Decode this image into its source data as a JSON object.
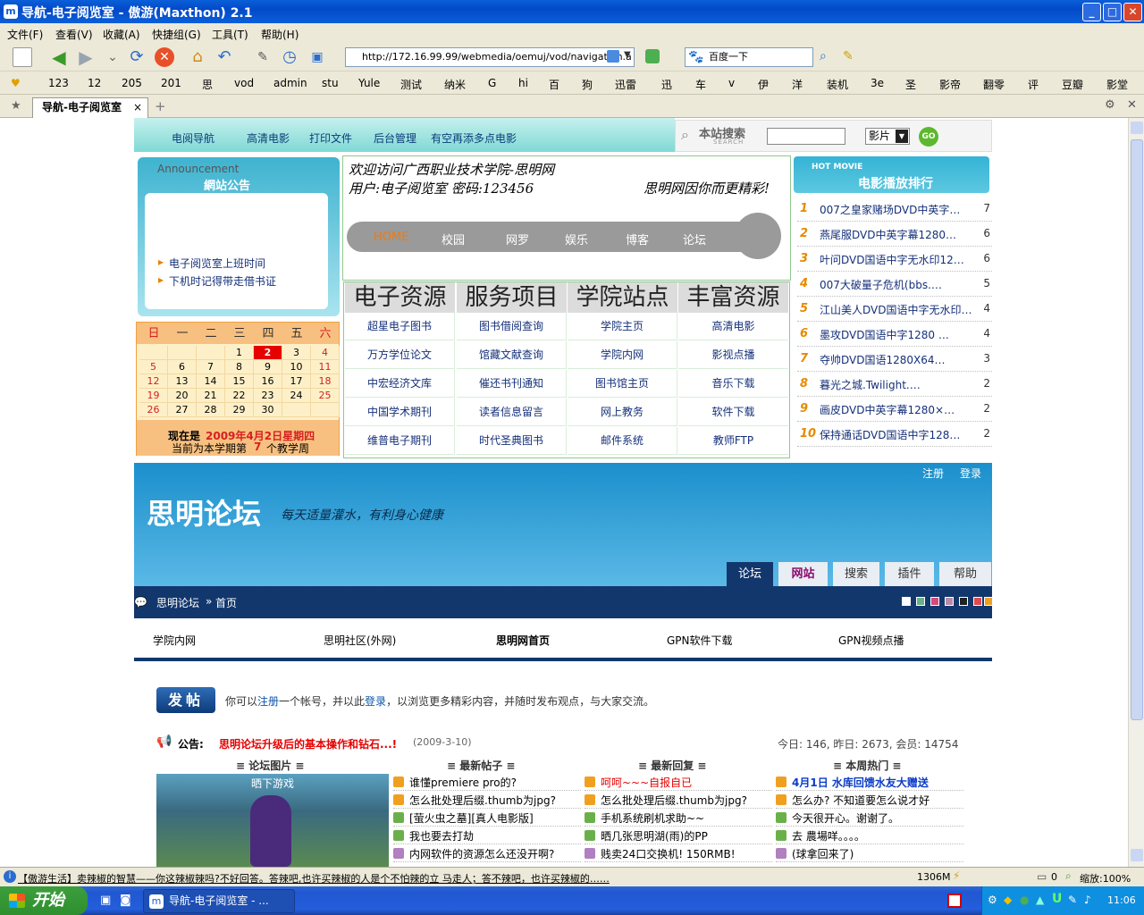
{
  "window": {
    "title": "导航-电子阅览室 - 傲游(Maxthon) 2.1",
    "buttons": [
      "_",
      "□",
      "✕"
    ]
  },
  "menu": [
    "文件(F)",
    "查看(V)",
    "收藏(A)",
    "快捷组(G)",
    "工具(T)",
    "帮助(H)"
  ],
  "toolbar": {
    "address": "http://172.16.99.99/webmedia/oemuj/vod/navigation.a",
    "search_placeholder": "百度一下"
  },
  "favorites": [
    "123",
    "12",
    "205",
    "201",
    "思",
    "vod",
    "admin",
    "stu",
    "Yule",
    "测试",
    "纳米",
    "G",
    "hi",
    "百",
    "狗",
    "迅雷",
    "迅",
    "车",
    "v",
    "伊",
    "洋",
    "装机",
    "3e",
    "圣",
    "影帝",
    "翻零",
    "评",
    "豆瓣",
    "影堂"
  ],
  "tab": {
    "label": "导航-电子阅览室"
  },
  "page": {
    "nav": [
      "电阅导航",
      "高清电影",
      "打印文件",
      "后台管理"
    ],
    "nav_note": "有空再添多点电影",
    "site_search": {
      "title": "本站搜索",
      "sub": "SEARCH",
      "select": "影片",
      "go": "GO"
    },
    "announcement": {
      "title_en": "Announcement",
      "title_cn": "網站公告",
      "items": [
        "电子阅览室上班时间",
        "下机时记得带走借书证"
      ]
    },
    "calendar": {
      "headers": [
        "日",
        "一",
        "二",
        "三",
        "四",
        "五",
        "六"
      ],
      "rows": [
        [
          "",
          "",
          "",
          "1",
          "2",
          "3",
          "4"
        ],
        [
          "5",
          "6",
          "7",
          "8",
          "9",
          "10",
          "11"
        ],
        [
          "12",
          "13",
          "14",
          "15",
          "16",
          "17",
          "18"
        ],
        [
          "19",
          "20",
          "21",
          "22",
          "23",
          "24",
          "25"
        ],
        [
          "26",
          "27",
          "28",
          "29",
          "30",
          "",
          ""
        ]
      ],
      "today": "2",
      "now_prefix": "现在是",
      "now_date": "2009年4月2日星期四",
      "week_prefix": "当前为本学期第",
      "week_num": "7",
      "week_suffix": "个教学周"
    },
    "welcome": {
      "line1": "欢迎访问广西职业技术学院-思明网",
      "line2": "用户:电子阅览室  密码:123456",
      "slogan": "思明网因你而更精彩!",
      "menu": [
        "HOME",
        "校园",
        "网罗",
        "娱乐",
        "博客",
        "论坛"
      ]
    },
    "grid": {
      "headers": [
        "电子资源",
        "服务项目",
        "学院站点",
        "丰富资源"
      ],
      "rows": [
        [
          "超星电子图书",
          "图书借阅查询",
          "学院主页",
          "高清电影"
        ],
        [
          "万方学位论文",
          "馆藏文献查询",
          "学院内网",
          "影视点播"
        ],
        [
          "中宏经济文库",
          "催还书刊通知",
          "图书馆主页",
          "音乐下载"
        ],
        [
          "中国学术期刊",
          "读者信息留言",
          "网上教务",
          "软件下载"
        ],
        [
          "维普电子期刊",
          "时代圣典图书",
          "邮件系统",
          "教师FTP"
        ]
      ]
    },
    "hot": {
      "title_en": "HOT MOVIE",
      "title_cn": "电影播放排行",
      "items": [
        {
          "n": "1",
          "t": "007之皇家赌场DVD中英字…",
          "c": "7"
        },
        {
          "n": "2",
          "t": "燕尾服DVD中英字幕1280…",
          "c": "6"
        },
        {
          "n": "3",
          "t": "叶问DVD国语中字无水印12…",
          "c": "6"
        },
        {
          "n": "4",
          "t": "007大破量子危机(bbs.…",
          "c": "5"
        },
        {
          "n": "5",
          "t": "江山美人DVD国语中字无水印…",
          "c": "4"
        },
        {
          "n": "6",
          "t": "墨攻DVD国语中字1280 …",
          "c": "4"
        },
        {
          "n": "7",
          "t": "夺帅DVD国语1280X64…",
          "c": "3"
        },
        {
          "n": "8",
          "t": "暮光之城.Twilight.…",
          "c": "2"
        },
        {
          "n": "9",
          "t": "画皮DVD中英字幕1280×…",
          "c": "2"
        },
        {
          "n": "10",
          "t": "保持通话DVD国语中字128…",
          "c": "2"
        }
      ]
    },
    "forum": {
      "register": "注册",
      "login": "登录",
      "logo": "思明论坛",
      "slogan": "每天适量灌水，有利身心健康",
      "tabs": [
        "论坛",
        "网站",
        "搜索",
        "插件",
        "帮助"
      ],
      "breadcrumb": [
        "思明论坛",
        "首页"
      ],
      "links": [
        "学院内网",
        "思明社区(外网)",
        "思明网首页",
        "GPN软件下载",
        "GPN视频点播"
      ],
      "post_btn": "发帖",
      "notice_pre": "你可以",
      "notice_reg": "注册",
      "notice_mid": "一个帐号，并以此",
      "notice_login": "登录",
      "notice_post": "，以浏览更多精彩内容，并随时发布观点，与大家交流。",
      "ann_label": "公告:",
      "ann_text": "思明论坛升级后的基本操作和钻石...!",
      "ann_date": "(2009-3-10)",
      "stats": "今日: 146, 昨日: 2673, 会员: 14754",
      "col_heads": [
        "≡ 论坛图片 ≡",
        "≡ 最新帖子 ≡",
        "≡ 最新回复 ≡",
        "≡ 本周热门 ≡"
      ],
      "pic_caption": "晒下游戏",
      "newest": [
        "谁懂premiere pro的?",
        "怎么批处理后缀.thumb为jpg?",
        "[萤火虫之墓][真人电影版]",
        "我也要去打劫",
        "内网软件的资源怎么还没开啊?"
      ],
      "replies": [
        "呵呵~~~自报自已",
        "怎么批处理后缀.thumb为jpg?",
        "手机系统刷机求助~~",
        "晒几张思明湖(雨)的PP",
        "贱卖24口交换机! 150RMB!"
      ],
      "hot": [
        "4月1日  水库回馈水友大赠送",
        "怎么办? 不知道要怎么说才好",
        "今天很开心。谢谢了。",
        "去  農場咩。。。。",
        "(球拿回来了)"
      ]
    }
  },
  "status": {
    "text": "【傲游生活】卖辣椒的智慧——你这辣椒辣吗?不好回答。答辣吧,也许买辣椒的人是个不怕辣的立 马走人；答不辣吧，也许买辣椒的……",
    "mem": "1306M",
    "zero": "0",
    "zoom": "缩放:100%"
  },
  "taskbar": {
    "start": "开始",
    "task": "导航-电子阅览室 - ...",
    "clock": "11:06"
  },
  "colors": {
    "titlebar": "#0a5fd8",
    "accent_red": "#e60000",
    "forum_blue": "#12376d"
  }
}
